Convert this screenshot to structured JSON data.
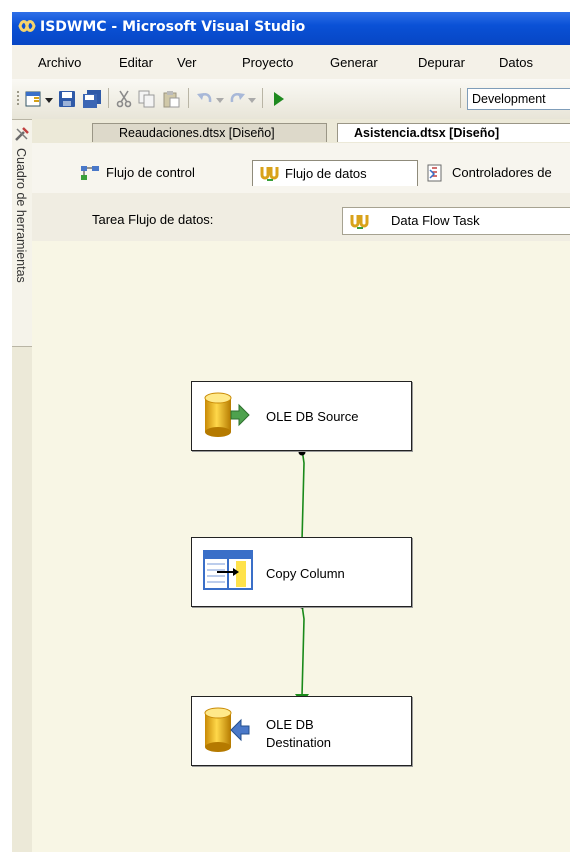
{
  "window": {
    "title": "ISDWMC - Microsoft Visual Studio"
  },
  "menu": [
    "Archivo",
    "Editar",
    "Ver",
    "Proyecto",
    "Generar",
    "Depurar",
    "Datos"
  ],
  "toolbar": {
    "config_value": "Development"
  },
  "toolbox": {
    "label": "Cuadro de herramientas"
  },
  "doc_tabs": [
    {
      "label": "Reaudaciones.dtsx [Diseño]"
    },
    {
      "label": "Asistencia.dtsx [Diseño]"
    }
  ],
  "designer_tabs": [
    {
      "label": "Flujo de control"
    },
    {
      "label": "Flujo de datos"
    },
    {
      "label": "Controladores de"
    }
  ],
  "task": {
    "label": "Tarea Flujo de datos:",
    "value": "Data Flow Task"
  },
  "nodes": [
    {
      "label": "OLE DB Source"
    },
    {
      "label": "Copy Column"
    },
    {
      "label_line1": "OLE DB",
      "label_line2": "Destination"
    }
  ],
  "colors": {
    "title_bar": "#0a51d6",
    "canvas": "#f8f6e5",
    "connector": "#1a8a1a"
  }
}
